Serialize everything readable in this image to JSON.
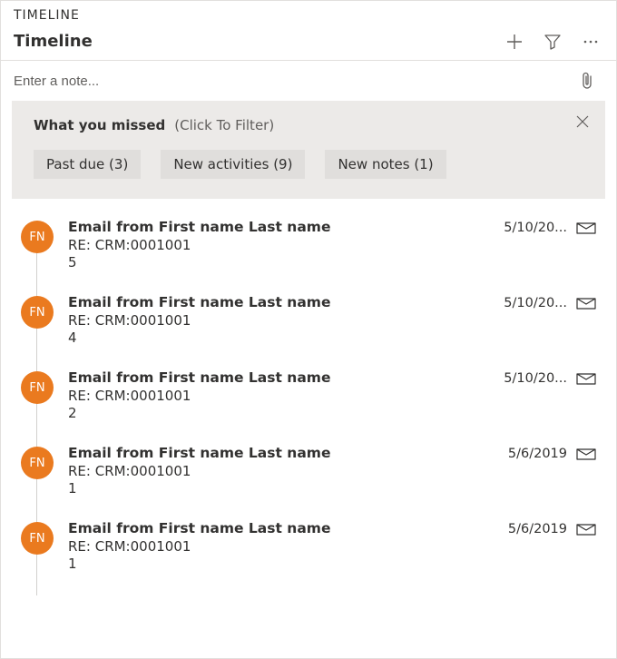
{
  "section_label": "TIMELINE",
  "header": {
    "title": "Timeline"
  },
  "note": {
    "placeholder": "Enter a note..."
  },
  "filter": {
    "title": "What you missed",
    "subtitle": "(Click To Filter)",
    "chips": [
      {
        "label": "Past due (3)"
      },
      {
        "label": "New activities (9)"
      },
      {
        "label": "New notes (1)"
      }
    ]
  },
  "avatar_initials": "FN",
  "items": [
    {
      "title": "Email from First name Last name",
      "subject": "RE: CRM:0001001",
      "num": "5",
      "date": "5/10/20..."
    },
    {
      "title": "Email from First name Last name",
      "subject": "RE: CRM:0001001",
      "num": "4",
      "date": "5/10/20..."
    },
    {
      "title": "Email from First name Last name",
      "subject": "RE: CRM:0001001",
      "num": "2",
      "date": "5/10/20..."
    },
    {
      "title": "Email from First name Last name",
      "subject": "RE: CRM:0001001",
      "num": "1",
      "date": "5/6/2019"
    },
    {
      "title": "Email from First name Last name",
      "subject": "RE: CRM:0001001",
      "num": "1",
      "date": "5/6/2019"
    }
  ]
}
